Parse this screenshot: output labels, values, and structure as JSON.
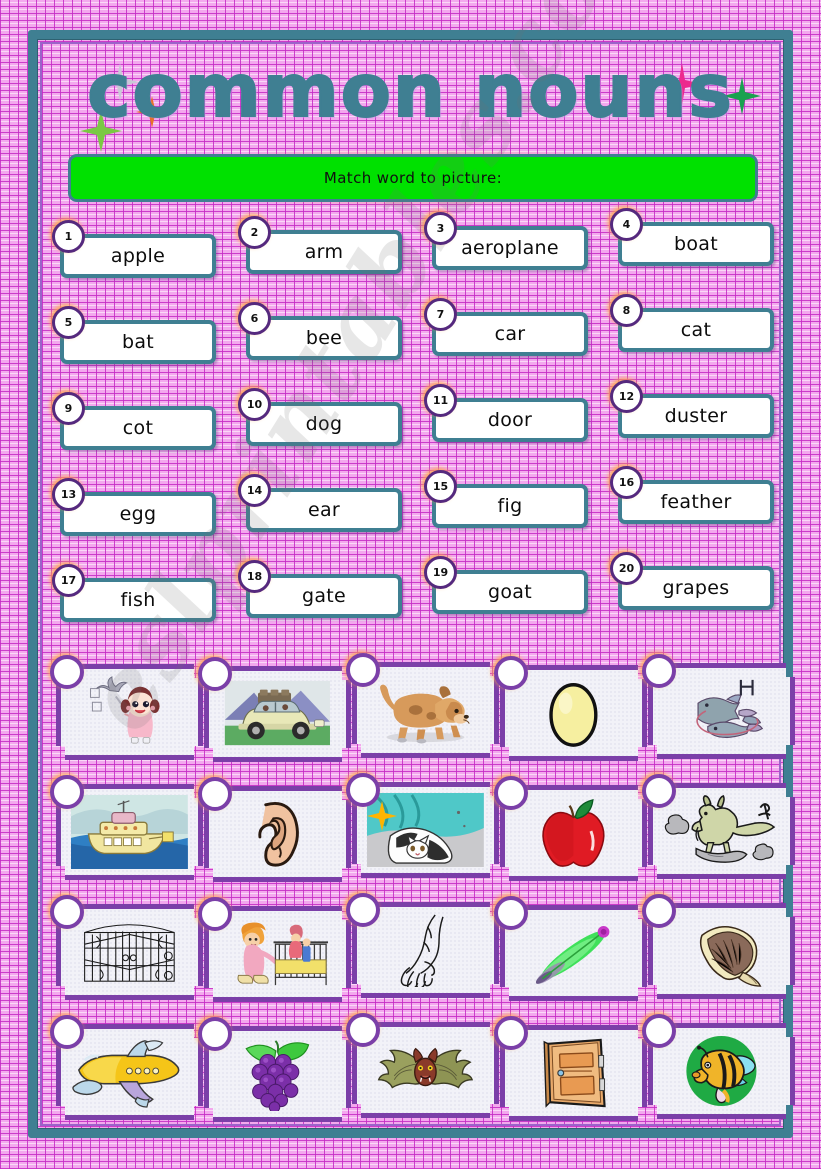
{
  "page": {
    "title": "common nouns",
    "instruction": "Match word to picture:",
    "watermark": "eslprintables.com",
    "colors": {
      "frame_teal": "#3f7f92",
      "card_purple": "#7b3fa8",
      "circle_purple": "#55297e",
      "instruction_green": "#00e100",
      "background_pink": "#f3a8ee",
      "title_teal": "#3f7f92"
    }
  },
  "words": [
    {
      "number": "1",
      "label": "apple"
    },
    {
      "number": "2",
      "label": "arm"
    },
    {
      "number": "3",
      "label": "aeroplane"
    },
    {
      "number": "4",
      "label": "boat"
    },
    {
      "number": "5",
      "label": "bat"
    },
    {
      "number": "6",
      "label": "bee"
    },
    {
      "number": "7",
      "label": "car"
    },
    {
      "number": "8",
      "label": "cat"
    },
    {
      "number": "9",
      "label": "cot"
    },
    {
      "number": "10",
      "label": "dog"
    },
    {
      "number": "11",
      "label": "door"
    },
    {
      "number": "12",
      "label": "duster"
    },
    {
      "number": "13",
      "label": "egg"
    },
    {
      "number": "14",
      "label": "ear"
    },
    {
      "number": "15",
      "label": "fig"
    },
    {
      "number": "16",
      "label": "feather"
    },
    {
      "number": "17",
      "label": "fish"
    },
    {
      "number": "18",
      "label": "gate"
    },
    {
      "number": "19",
      "label": "goat"
    },
    {
      "number": "20",
      "label": "grapes"
    }
  ],
  "pictures": [
    {
      "icon": "duster-picture",
      "answer": ""
    },
    {
      "icon": "car-picture",
      "answer": ""
    },
    {
      "icon": "dog-picture",
      "answer": ""
    },
    {
      "icon": "egg-picture",
      "answer": ""
    },
    {
      "icon": "fish-picture",
      "answer": ""
    },
    {
      "icon": "boat-picture",
      "answer": ""
    },
    {
      "icon": "ear-picture",
      "answer": ""
    },
    {
      "icon": "cat-picture",
      "answer": ""
    },
    {
      "icon": "apple-picture",
      "answer": ""
    },
    {
      "icon": "goat-picture",
      "answer": ""
    },
    {
      "icon": "gate-picture",
      "answer": ""
    },
    {
      "icon": "cot-picture",
      "answer": ""
    },
    {
      "icon": "arm-picture",
      "answer": ""
    },
    {
      "icon": "feather-picture",
      "answer": ""
    },
    {
      "icon": "fig-picture",
      "answer": ""
    },
    {
      "icon": "aeroplane-picture",
      "answer": ""
    },
    {
      "icon": "grapes-picture",
      "answer": ""
    },
    {
      "icon": "bat-picture",
      "answer": ""
    },
    {
      "icon": "door-picture",
      "answer": ""
    },
    {
      "icon": "bee-picture",
      "answer": ""
    }
  ],
  "stars": [
    {
      "name": "star-green-left",
      "color": "#7ac943"
    },
    {
      "name": "star-orange-left",
      "color": "#e8702a"
    },
    {
      "name": "star-silver-top",
      "color": "#c9c9d6"
    },
    {
      "name": "star-pink-right",
      "color": "#ec2a8e"
    },
    {
      "name": "star-green-right",
      "color": "#1aa14f"
    },
    {
      "name": "star-gold-middle",
      "color": "#ffb400"
    }
  ]
}
